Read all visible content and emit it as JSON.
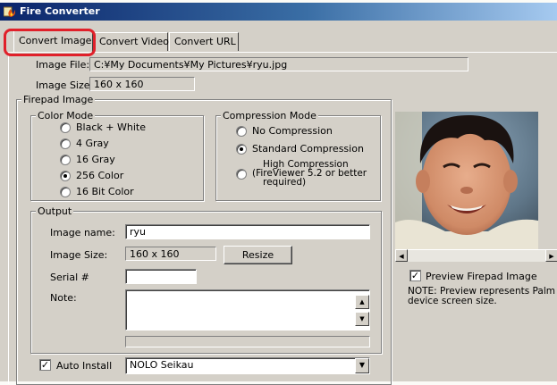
{
  "window": {
    "title": "Fire Converter"
  },
  "tabs": [
    {
      "label": "Convert Image",
      "selected": true
    },
    {
      "label": "Convert Video",
      "selected": false
    },
    {
      "label": "Convert URL",
      "selected": false
    }
  ],
  "image_file": {
    "label": "Image File:",
    "value": "C:¥My Documents¥My Pictures¥ryu.jpg"
  },
  "image_size": {
    "label": "Image Size:",
    "value": "160 x 160"
  },
  "firepad_image": {
    "label": "Firepad Image",
    "color_mode": {
      "label": "Color Mode",
      "options": [
        {
          "label": "Black + White",
          "selected": false
        },
        {
          "label": "4 Gray",
          "selected": false
        },
        {
          "label": "16 Gray",
          "selected": false
        },
        {
          "label": "256 Color",
          "selected": true
        },
        {
          "label": "16 Bit Color",
          "selected": false
        }
      ]
    },
    "compression_mode": {
      "label": "Compression Mode",
      "options": [
        {
          "label": "No Compression",
          "selected": false
        },
        {
          "label": "Standard Compression",
          "selected": true
        },
        {
          "label_lines": [
            "High Compression",
            "(FireViewer 5.2 or better",
            "required)"
          ],
          "selected": false
        }
      ]
    }
  },
  "output": {
    "label": "Output",
    "image_name": {
      "label": "Image name:",
      "value": "ryu"
    },
    "image_size": {
      "label": "Image Size:",
      "value": "160 x 160"
    },
    "resize_label": "Resize",
    "serial": {
      "label": "Serial #",
      "value": ""
    },
    "note": {
      "label": "Note:",
      "value": ""
    }
  },
  "auto_install": {
    "label": "Auto Install",
    "checked": true,
    "selected_user": "NOLO Seikau"
  },
  "preview": {
    "checkbox_label": "Preview Firepad Image",
    "checked": true,
    "note": "NOTE: Preview represents Palm device screen size."
  },
  "colors": {
    "title_start": "#0a246a",
    "title_end": "#a6caf0",
    "highlight": "#e0202a",
    "face": "#d4d0c8"
  }
}
